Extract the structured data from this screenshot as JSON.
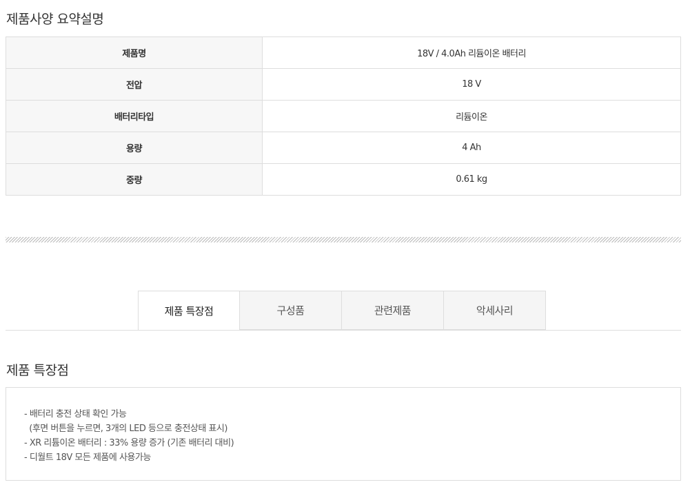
{
  "spec_summary": {
    "title": "제품사양 요약설명",
    "rows": [
      {
        "label": "제품명",
        "value": "18V / 4.0Ah 리듐이온 배터리"
      },
      {
        "label": "전압",
        "value": "18 V"
      },
      {
        "label": "배터리타입",
        "value": "리듐이온"
      },
      {
        "label": "용량",
        "value": "4 Ah"
      },
      {
        "label": "중량",
        "value": "0.61 kg"
      }
    ]
  },
  "tabs": [
    {
      "label": "제품 특장점",
      "active": true
    },
    {
      "label": "구성품",
      "active": false
    },
    {
      "label": "관련제품",
      "active": false
    },
    {
      "label": "악세사리",
      "active": false
    }
  ],
  "features": {
    "title": "제품 특장점",
    "lines": [
      "- 배터리 충전 상태 확인 가능",
      "  (후면 버튼을 누르면, 3개의 LED 등으로 충전상태 표시)",
      "- XR 리튬이온 배터리 : 33% 용량 증가 (기존 배터리 대비)",
      "- 디월트 18V 모든 제품에 사용가능"
    ]
  }
}
